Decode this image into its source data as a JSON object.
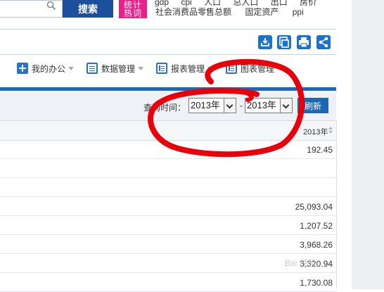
{
  "search": {
    "placeholder": "",
    "button_label": "搜索"
  },
  "hot_words": {
    "badge_line1": "统计",
    "badge_line2": "热词",
    "row1": [
      "gdp",
      "cpi",
      "人口",
      "总人口",
      "出口",
      "房价"
    ],
    "row2": [
      "社会消费品零售总额",
      "固定资产",
      "ppi"
    ]
  },
  "toolbar_icons": [
    "download-icon",
    "copy-icon",
    "print-icon",
    "share-icon"
  ],
  "nav": {
    "items": [
      {
        "label": "我的办公",
        "icon": "plus-icon"
      },
      {
        "label": "数据管理",
        "icon": "document-icon"
      },
      {
        "label": "报表管理",
        "icon": "table-icon"
      },
      {
        "label": "图表管理",
        "icon": "chart-icon"
      }
    ]
  },
  "query": {
    "label": "查询时间：",
    "start_value": "2013年",
    "separator": "-",
    "end_value": "2013年",
    "refresh_label": "刷新"
  },
  "table": {
    "column_header": "2013年",
    "rows": [
      "192.45",
      "",
      "",
      "25,093.04",
      "1,207.52",
      "3,968.26",
      "3,320.94",
      "1,730.08"
    ]
  },
  "colors": {
    "accent_blue": "#1c68b7",
    "search_button": "#1c4f9c",
    "hot_badge": "#e7208a",
    "annotation_red": "#e8000b"
  },
  "watermark": "Bai 经验"
}
